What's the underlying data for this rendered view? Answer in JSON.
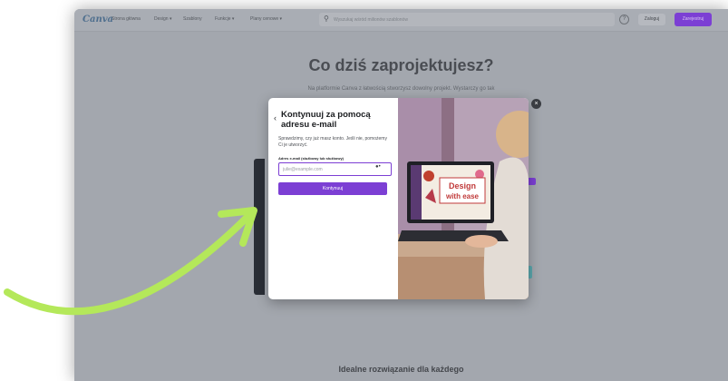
{
  "app": {
    "logo": "Canva"
  },
  "nav": {
    "items": [
      "Strona główna",
      "Design ▾",
      "Szablony",
      "Funkcje ▾",
      "Plany cenowe ▾"
    ],
    "search_placeholder": "Wyszukaj wśród milionów szablonów",
    "help": "?",
    "login": "Zaloguj",
    "signup": "Zarejestruj"
  },
  "hero": {
    "title": "Co dziś zaprojektujesz?",
    "subtitle": "Na platformie Canva z łatwością stworzysz dowolny projekt. Wystarczy go tak"
  },
  "section": {
    "title": "Idealne rozwiązanie dla każdego"
  },
  "modal": {
    "title": "Kontynuuj za pomocą adresu e-mail",
    "description": "Sprawdzimy, czy już masz konto. Jeśli nie, pomożemy Ci je utworzyć.",
    "email_label": "Adres e-mail (służbowy lub służbowy)",
    "email_placeholder": "julie@example.com",
    "email_value": "",
    "continue": "Kontynuuj",
    "back": "‹",
    "close": "×",
    "image_text": [
      "Design",
      "with ease"
    ]
  },
  "colors": {
    "accent": "#7c3fd4",
    "arrow": "#b4e85a",
    "overlay": "#a3a7ae"
  },
  "icons": [
    "back-chevron-icon",
    "close-icon",
    "search-icon",
    "help-icon",
    "password-manager-icon",
    "curved-arrow-icon"
  ]
}
